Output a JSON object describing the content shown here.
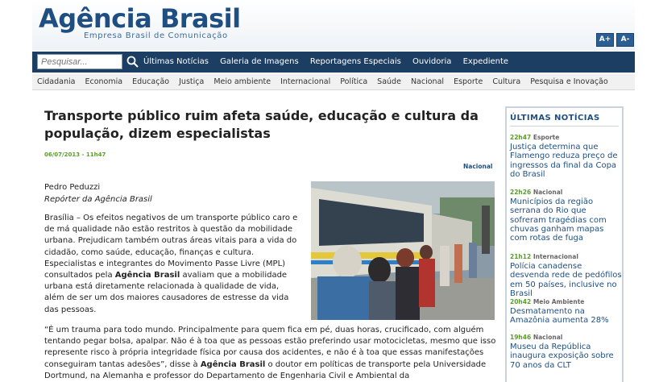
{
  "header": {
    "logo_title": "Agência Brasil",
    "logo_subtitle": "Empresa Brasil de Comunicação",
    "font_increase": "A+",
    "font_decrease": "A-"
  },
  "nav": {
    "search_placeholder": "Pesquisar...",
    "links": [
      "Últimas Notícias",
      "Galeria de Imagens",
      "Reportagens Especiais",
      "Ouvidoria",
      "Expediente"
    ]
  },
  "categories": [
    "Cidadania",
    "Economia",
    "Educação",
    "Justiça",
    "Meio ambiente",
    "Internacional",
    "Política",
    "Saúde",
    "Nacional",
    "Esporte",
    "Cultura",
    "Pesquisa e Inovação"
  ],
  "article": {
    "title": "Transporte público ruim afeta saúde, educação e cultura da população, dizem especialistas",
    "date": "06/07/2013 - 11h47",
    "section": "Nacional",
    "author": "Pedro Peduzzi",
    "author_role": "Repórter da Agência Brasil",
    "para1_a": "Brasília – Os efeitos negativos de um transporte público caro e de má qualidade não estão restritos à questão da mobilidade urbana. Prejudicam também outras áreas vitais para a vida do cidadão, como saúde, educação, finanças e cultura. Especialistas e integrantes do Movimento Passe Livre (MPL) consultados pela ",
    "para1_bold": "Agência Brasil",
    "para1_b": " avaliam que a mobilidade urbana está diretamente relacionada à qualidade de vida, além de ser um dos maiores causadores de estresse da vida das pessoas.",
    "quote_a": "“É um trauma para todo mundo. Principalmente para quem fica em pé, duas horas, crucificado, com alguém tentando pegar bolsa, apalpar. Não é à toa que as pessoas estão preferindo usar motocicletas, mesmo que isso represente risco à própria integridade física por causa dos acidentes, e não é à toa que essas manifestações conseguiram tantas adesões”, disse à ",
    "quote_bold": "Agência Brasil",
    "quote_b": " o doutor em políticas de transporte pela Universidade Dortmund, na Alemanha e professor do Departamento de Engenharia Civil e Ambiental da"
  },
  "sidebar": {
    "title": "ÚLTIMAS NOTÍCIAS",
    "items": [
      {
        "time": "22h47",
        "category": "Esporte",
        "text": "Justiça determina que Flamengo reduza preço de ingressos da final da Copa do Brasil"
      },
      {
        "time": "22h26",
        "category": "Nacional",
        "text": "Municípios da região serrana do Rio que sofreram tragédias com chuvas ganham mapas com rotas de fuga"
      },
      {
        "time": "21h12",
        "category": "Internacional",
        "text": "Polícia canadense desvenda rede de pedófilos em 50 países, inclusive no Brasil"
      },
      {
        "time": "20h42",
        "category": "Meio Ambiente",
        "text": "Desmatamento na Amazônia aumenta 28%"
      },
      {
        "time": "19h46",
        "category": "Nacional",
        "text": "Museu da República inaugura exposição sobre 70 anos da CLT"
      }
    ]
  },
  "colors": {
    "brand": "#1f4f82",
    "nav": "#1c3e62",
    "time": "#5a9e28"
  }
}
